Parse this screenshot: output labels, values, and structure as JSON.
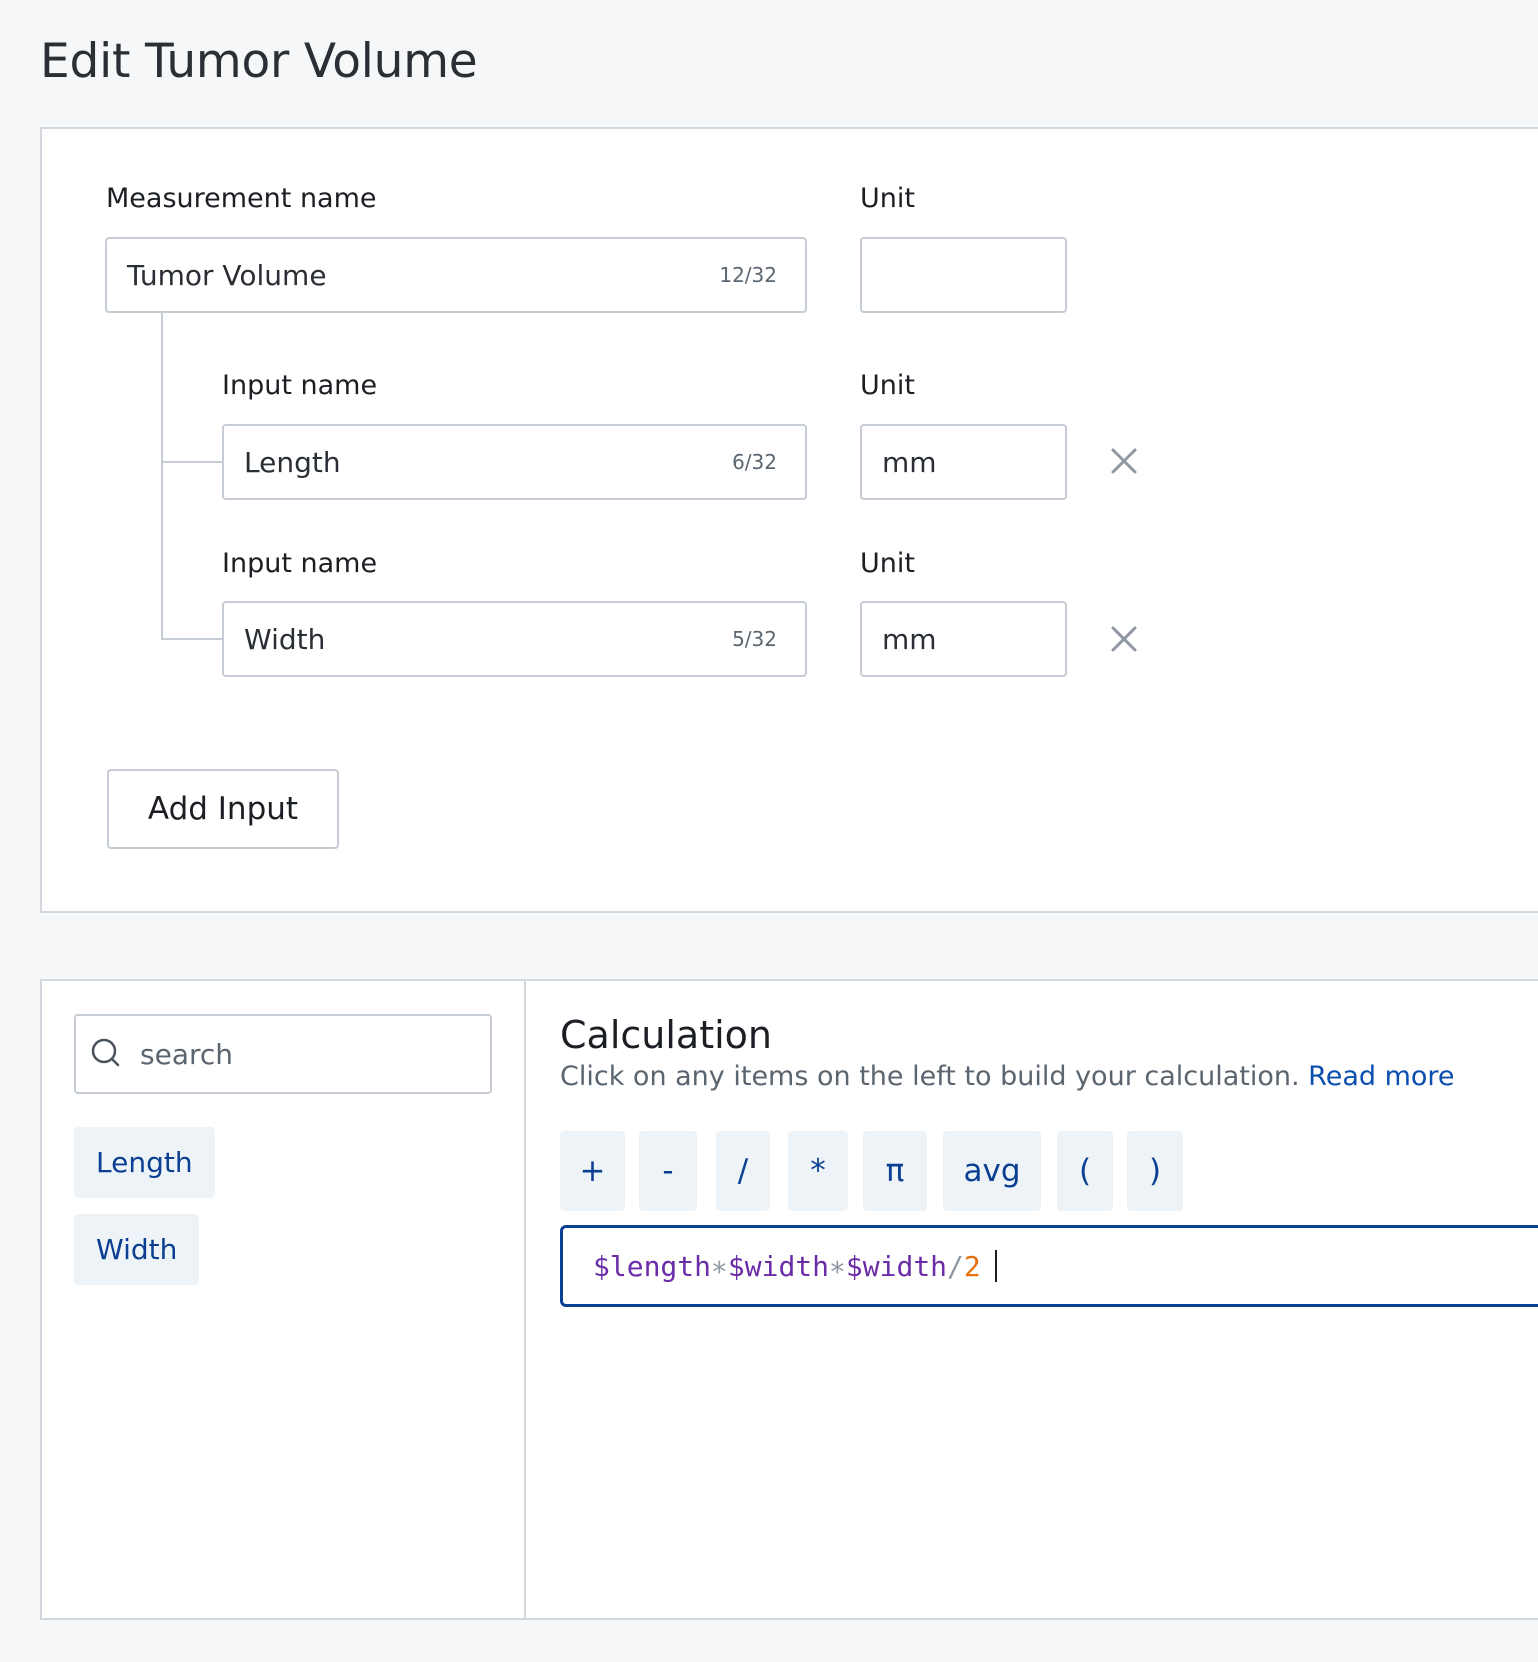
{
  "page": {
    "title": "Edit Tumor Volume"
  },
  "measurement": {
    "name_label": "Measurement name",
    "name_value": "Tumor Volume",
    "name_counter": "12/32",
    "unit_label": "Unit",
    "unit_value": ""
  },
  "inputs": [
    {
      "name_label": "Input name",
      "name_value": "Length",
      "counter": "6/32",
      "unit_label": "Unit",
      "unit_value": "mm"
    },
    {
      "name_label": "Input name",
      "name_value": "Width",
      "counter": "5/32",
      "unit_label": "Unit",
      "unit_value": "mm"
    }
  ],
  "add_input_label": "Add Input",
  "search": {
    "placeholder": "search"
  },
  "variables": [
    "Length",
    "Width"
  ],
  "calculation": {
    "title": "Calculation",
    "description": "Click on any items on the left to build your calculation.",
    "read_more": "Read more",
    "operators": [
      "+",
      "-",
      "/",
      "*",
      "π",
      "avg",
      "(",
      ")"
    ],
    "formula_tokens": [
      {
        "type": "var",
        "text": "$length"
      },
      {
        "type": "op",
        "text": "∗"
      },
      {
        "type": "var",
        "text": "$width"
      },
      {
        "type": "op",
        "text": "∗"
      },
      {
        "type": "var",
        "text": "$width"
      },
      {
        "type": "op",
        "text": "/"
      },
      {
        "type": "num",
        "text": "2"
      }
    ]
  },
  "colors": {
    "accent": "#0a3f91",
    "link": "#0a4fb0",
    "variable": "#6b2ca8",
    "operator": "#8f98a2",
    "number": "#e6700a"
  },
  "icons": {
    "remove": "close-icon",
    "search": "search-icon"
  }
}
